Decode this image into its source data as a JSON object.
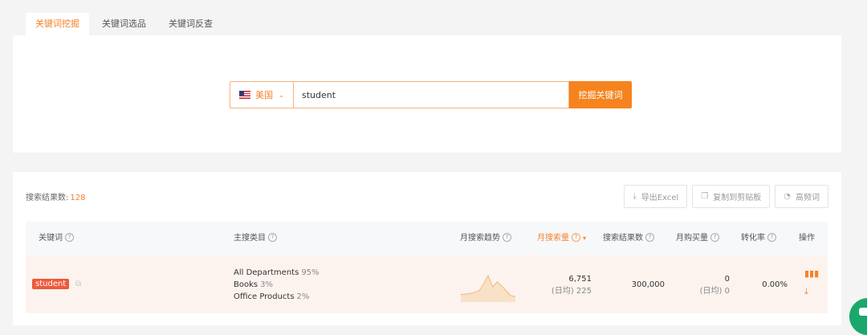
{
  "tabs": [
    {
      "label": "关键词挖掘",
      "active": true
    },
    {
      "label": "关键词选品",
      "active": false
    },
    {
      "label": "关键词反查",
      "active": false
    }
  ],
  "search": {
    "country": "美国",
    "flag_icon": "us-flag-icon",
    "value": "student",
    "button_label": "挖掘关键词"
  },
  "results": {
    "count_label": "搜索结果数:",
    "count": "128"
  },
  "toolbar": {
    "export_label": "导出Excel",
    "copy_label": "复制到剪贴板",
    "advanced_label": "高频词"
  },
  "table": {
    "headers": {
      "keyword": "关键词",
      "category": "主搜类目",
      "trend": "月搜索趋势",
      "monthly_search": "月搜索量",
      "result_count": "搜索结果数",
      "monthly_purchase": "月购买量",
      "conversion": "转化率",
      "action": "操作"
    },
    "rows": [
      {
        "keyword": "student",
        "categories": [
          {
            "name": "All Departments",
            "pct": "95%"
          },
          {
            "name": "Books",
            "pct": "3%"
          },
          {
            "name": "Office Products",
            "pct": "2%"
          }
        ],
        "trend": [
          0.18,
          0.2,
          0.22,
          0.25,
          0.3,
          0.5,
          0.78,
          0.42,
          0.58,
          0.45,
          0.3,
          0.15,
          0.12
        ],
        "monthly_search": "6,751",
        "daily_search": "(日均) 225",
        "result_count": "300,000",
        "monthly_purchase": "0",
        "daily_purchase": "(日均) 0",
        "conversion": "0.00%"
      }
    ]
  },
  "colors": {
    "accent": "#f5822b",
    "tag": "#ef5a3c",
    "row_highlight": "#fcf3ef"
  }
}
